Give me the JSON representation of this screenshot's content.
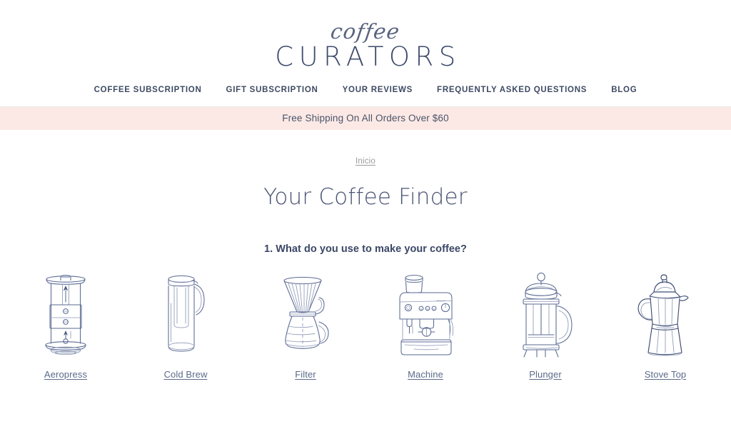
{
  "header": {
    "logo_script": "coffee",
    "logo_word": "CURATORS",
    "nav": [
      {
        "label": "COFFEE SUBSCRIPTION",
        "name": "nav-coffee-subscription"
      },
      {
        "label": "GIFT SUBSCRIPTION",
        "name": "nav-gift-subscription"
      },
      {
        "label": "YOUR REVIEWS",
        "name": "nav-your-reviews"
      },
      {
        "label": "FREQUENTLY ASKED QUESTIONS",
        "name": "nav-faq"
      },
      {
        "label": "BLOG",
        "name": "nav-blog"
      }
    ]
  },
  "promo": {
    "text": "Free Shipping On All Orders Over $60",
    "background_color": "#fce9e6",
    "text_color": "#4a5468"
  },
  "breadcrumb": {
    "items": [
      "Inicio"
    ]
  },
  "main": {
    "title": "Your Coffee Finder",
    "question": "1. What do you use to make your coffee?",
    "options": [
      {
        "label": "Aeropress",
        "icon": "aeropress-icon"
      },
      {
        "label": "Cold Brew",
        "icon": "cold-brew-carafe-icon"
      },
      {
        "label": "Filter",
        "icon": "pour-over-filter-icon"
      },
      {
        "label": "Machine",
        "icon": "espresso-machine-icon"
      },
      {
        "label": "Plunger",
        "icon": "french-press-icon"
      },
      {
        "label": "Stove Top",
        "icon": "moka-pot-icon"
      }
    ]
  },
  "colors": {
    "ink": "#5b6a93",
    "ink_dark": "#3f4d74",
    "link": "#5b6a8a",
    "heading": "#4a5574",
    "nav": "#3e4a63",
    "page_background": "#ffffff"
  }
}
